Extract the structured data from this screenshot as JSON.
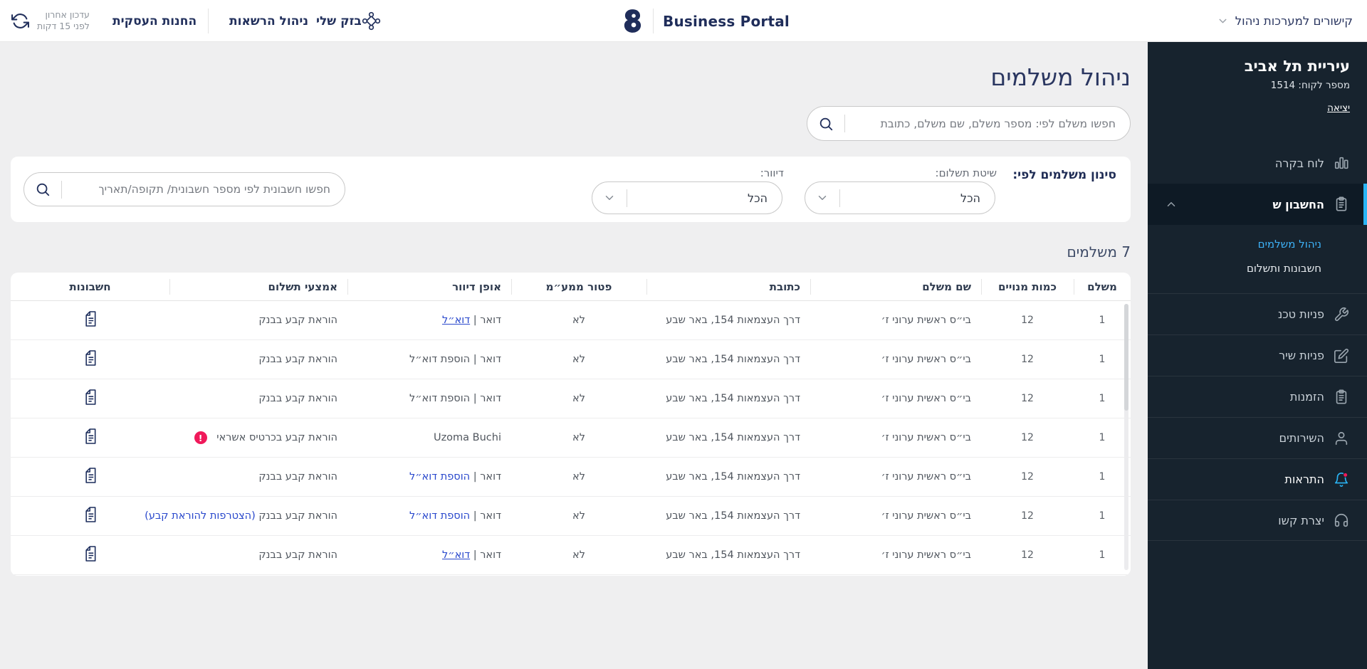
{
  "topbar": {
    "update_line1": "עדכון אחרון",
    "update_line2": "לפני 15 דקות",
    "store_link": "החנות העסקית",
    "permissions_link": "ניהול הרשאות",
    "my_bezeq_link": "בזק שלי",
    "brand": "Business Portal",
    "systems_links": "קישורים למערכות ניהול"
  },
  "sidebar": {
    "org_name": "עיריית תל אביב",
    "customer_number": "מספר לקוח: 1514",
    "logout": "יציאה",
    "accent_color": "#2ab5f6",
    "items": [
      {
        "label": "לוח בקרה"
      },
      {
        "label": "החשבון ש"
      },
      {
        "label": "ניהול משלמים"
      },
      {
        "label": "חשבונות ותשלום"
      },
      {
        "label": "פניות טכנ"
      },
      {
        "label": "פניות שיר"
      },
      {
        "label": "הזמנות"
      },
      {
        "label": "השירותים"
      },
      {
        "label": "התראות"
      },
      {
        "label": "יצרת קשו"
      }
    ]
  },
  "main": {
    "title": "ניהול משלמים",
    "search_placeholder": "חפשו משלם לפי: מספר משלם, שם משלם, כתובת",
    "filter": {
      "title": "סינון משלמים לפי:",
      "payment_method_label": "שיטת תשלום:",
      "payment_method_value": "הכל",
      "mailing_label": "דיוור:",
      "mailing_value": "הכל",
      "invoice_search_placeholder": "חפשו חשבונית לפי מספר חשבונית/ תקופה/תאריך"
    },
    "count_label": "7 משלמים",
    "table": {
      "headers": [
        "משלם",
        "כמות מנויים",
        "שם משלם",
        "כתובת",
        "פטור ממע״מ",
        "אופן דיוור",
        "אמצעי תשלום",
        "חשבונות"
      ],
      "rows": [
        {
          "payer": "1",
          "subscribers": "12",
          "name": "בי״ס ראשית ערוני ז׳",
          "address": "דרך העצמאות 154,  באר שבע",
          "vat_exempt": "לא",
          "mailing": {
            "prefix": "דואר |",
            "link": "דוא״ל",
            "cls": "mlink u"
          },
          "payment": {
            "text": "הוראת קבע בבנק",
            "link": "",
            "badge": "",
            "badge_cls": "pay-badge off"
          }
        },
        {
          "payer": "1",
          "subscribers": "12",
          "name": "בי״ס ראשית ערוני ז׳",
          "address": "דרך העצמאות 154,  באר שבע",
          "vat_exempt": "לא",
          "mailing": {
            "prefix": "דואר |",
            "link": "הוספת דוא״ל",
            "cls": "mplain"
          },
          "payment": {
            "text": "הוראת קבע בבנק",
            "link": "",
            "badge": "",
            "badge_cls": "pay-badge off"
          }
        },
        {
          "payer": "1",
          "subscribers": "12",
          "name": "בי״ס ראשית ערוני ז׳",
          "address": "דרך העצמאות 154,  באר שבע",
          "vat_exempt": "לא",
          "mailing": {
            "prefix": "דואר |",
            "link": "הוספת דוא״ל",
            "cls": "mplain"
          },
          "payment": {
            "text": "הוראת קבע בבנק",
            "link": "",
            "badge": "",
            "badge_cls": "pay-badge off"
          }
        },
        {
          "payer": "1",
          "subscribers": "12",
          "name": "בי״ס ראשית ערוני ז׳",
          "address": "דרך העצמאות 154,  באר שבע",
          "vat_exempt": "לא",
          "mailing": {
            "prefix": "",
            "link": "Uzoma Buchi",
            "cls": "mplain"
          },
          "payment": {
            "text": "הוראת קבע בכרטיס אשראי",
            "link": "",
            "badge": "!",
            "badge_cls": "pay-badge"
          }
        },
        {
          "payer": "1",
          "subscribers": "12",
          "name": "בי״ס ראשית ערוני ז׳",
          "address": "דרך העצמאות 154,  באר שבע",
          "vat_exempt": "לא",
          "mailing": {
            "prefix": "דואר |",
            "link": "הוספת דוא״ל",
            "cls": "mlink"
          },
          "payment": {
            "text": "הוראת קבע בבנק",
            "link": "",
            "badge": "",
            "badge_cls": "pay-badge off"
          }
        },
        {
          "payer": "1",
          "subscribers": "12",
          "name": "בי״ס ראשית ערוני ז׳",
          "address": "דרך העצמאות 154,  באר שבע",
          "vat_exempt": "לא",
          "mailing": {
            "prefix": "דואר |",
            "link": "הוספת דוא״ל",
            "cls": "mlink"
          },
          "payment": {
            "text": "הוראת קבע בבנק",
            "link": "(הצטרפות להוראת קבע)",
            "badge": "",
            "badge_cls": "pay-badge off"
          }
        },
        {
          "payer": "1",
          "subscribers": "12",
          "name": "בי״ס ראשית ערוני ז׳",
          "address": "דרך העצמאות 154,  באר שבע",
          "vat_exempt": "לא",
          "mailing": {
            "prefix": "דואר |",
            "link": "דוא״ל",
            "cls": "mlink u"
          },
          "payment": {
            "text": "הוראת קבע בבנק",
            "link": "",
            "badge": "",
            "badge_cls": "pay-badge off"
          }
        }
      ]
    }
  }
}
